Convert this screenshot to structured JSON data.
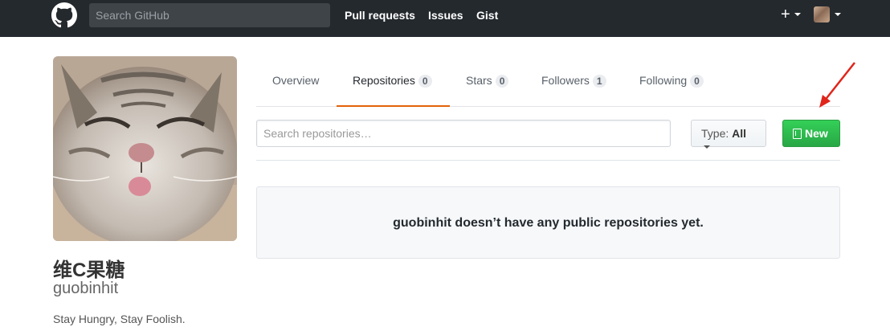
{
  "header": {
    "search_placeholder": "Search GitHub",
    "nav": [
      "Pull requests",
      "Issues",
      "Gist"
    ],
    "plus_label": "+",
    "bg_color": "#24292e"
  },
  "profile": {
    "full_name": "维C果糖",
    "username": "guobinhit",
    "bio": "Stay Hungry, Stay Foolish."
  },
  "tabs": [
    {
      "label": "Overview",
      "count": null
    },
    {
      "label": "Repositories",
      "count": "0",
      "selected": true
    },
    {
      "label": "Stars",
      "count": "0"
    },
    {
      "label": "Followers",
      "count": "1"
    },
    {
      "label": "Following",
      "count": "0"
    }
  ],
  "repos": {
    "search_placeholder": "Search repositories…",
    "type_label": "Type:",
    "type_value": "All",
    "new_label": "New",
    "empty_message": "guobinhit doesn’t have any public repositories yet."
  },
  "colors": {
    "accent_tab": "#e36209",
    "new_button": "#28a745",
    "annotation_arrow": "#e0251b"
  },
  "icons": [
    "github-logo-icon",
    "plus-icon",
    "caret-down-icon",
    "book-icon",
    "red-arrow-annotation"
  ]
}
